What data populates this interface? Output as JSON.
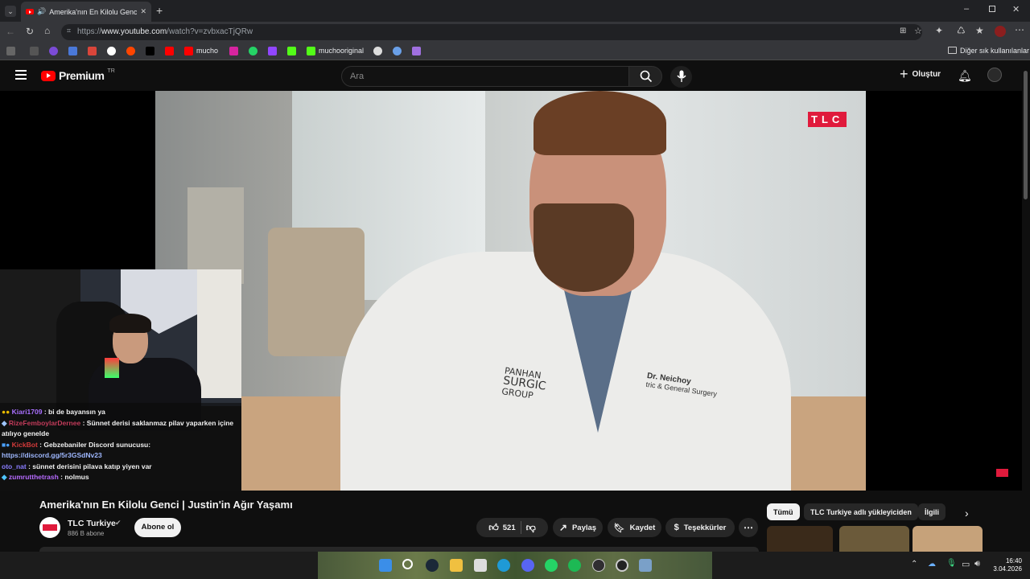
{
  "browser": {
    "tab_title": "Amerika'nın En Kilolu Genci |",
    "url_prefix": "https://",
    "url_domain": "www.youtube.com",
    "url_path": "/watch?v=zvbxacTjQRw",
    "bookmarks": [
      "mucho",
      "muchooriginal"
    ],
    "other_bookmarks": "Diğer sık kullanılanlar"
  },
  "youtube": {
    "logo_text": "Premium",
    "logo_badge": "TR",
    "search_placeholder": "Ara",
    "create_label": "Oluştur"
  },
  "video": {
    "channel_watermark": "TLC",
    "title": "Amerika'nın En Kilolu Genci | Justin'in Ağır Yaşamı",
    "coat_text_1": "PANHAN",
    "coat_text_2": "SURGIC",
    "coat_text_3": "GROUP",
    "coat_name": "Dr. Neichoy",
    "coat_dept": "tric & General Surgery"
  },
  "stream_chat": [
    {
      "user": "Kiari1709",
      "user_color": "#a970ff",
      "message": ": bi de bayansın ya"
    },
    {
      "user": "RizeFemboylarDernee",
      "user_color": "#c23b5a",
      "message": ": Sünnet derisi saklanmaz pilav yaparken içine atılıyo genelde"
    },
    {
      "user": "KickBot",
      "user_color": "#d23a3a",
      "message": ": Gebzebaniler Discord sunucusu:",
      "link": "https://discord.gg/5r3GSdNv23"
    },
    {
      "user": "oto_nat",
      "user_color": "#8a7dff",
      "message": ": sünnet derisini pilava katıp yiyen var"
    },
    {
      "user": "zumrutthetrash",
      "user_color": "#b76bff",
      "message": ": nolmus"
    }
  ],
  "channel": {
    "name": "TLC Turkiye",
    "subscribers": "886 B abone",
    "subscribe_label": "Abone ol"
  },
  "actions": {
    "like_count": "521",
    "share_label": "Paylaş",
    "save_label": "Kaydet",
    "thanks_label": "Teşekkürler"
  },
  "filter_chips": [
    "Tümü",
    "TLC Turkiye adlı yükleyiciden",
    "İlgili"
  ],
  "taskbar": {
    "time": "16:40",
    "date": "3.04.2026"
  },
  "colors": {
    "youtube_red": "#ff0000",
    "tlc_red": "#e01a3c",
    "background": "#0f0f0f"
  }
}
